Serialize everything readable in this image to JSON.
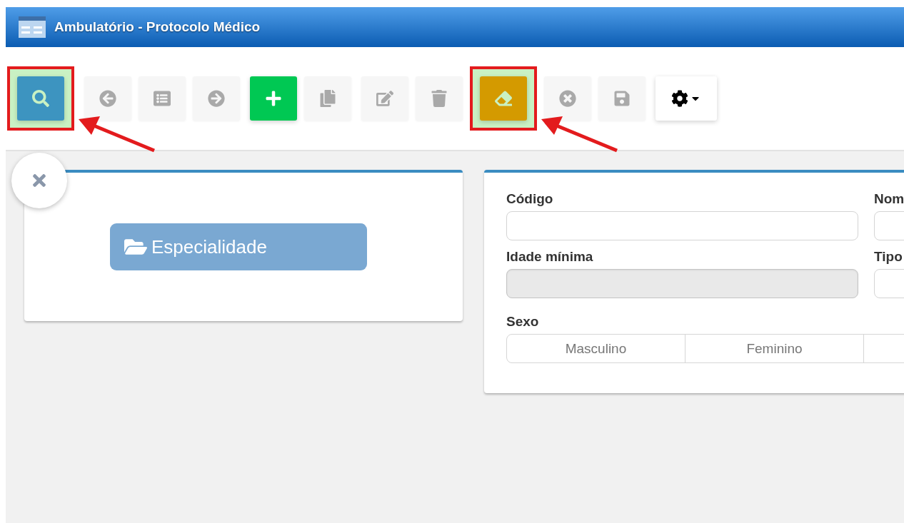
{
  "window": {
    "title": "Ambulatório - Protocolo Médico"
  },
  "toolbar": {
    "groups": [
      {
        "buttons": [
          {
            "kind": "search",
            "disabled": false,
            "marked": true
          }
        ]
      },
      {
        "buttons": [
          {
            "kind": "previous",
            "disabled": true,
            "marked": false
          },
          {
            "kind": "list",
            "disabled": true,
            "marked": false
          },
          {
            "kind": "next",
            "disabled": true,
            "marked": false
          }
        ]
      },
      {
        "buttons": [
          {
            "kind": "new",
            "disabled": false,
            "marked": false
          },
          {
            "kind": "copy",
            "disabled": true,
            "marked": false
          }
        ]
      },
      {
        "buttons": [
          {
            "kind": "edit",
            "disabled": true,
            "marked": false
          },
          {
            "kind": "delete",
            "disabled": true,
            "marked": false
          },
          {
            "kind": "clear",
            "disabled": false,
            "marked": true
          },
          {
            "kind": "cancel",
            "disabled": true,
            "marked": false
          },
          {
            "kind": "save",
            "disabled": true,
            "marked": false
          }
        ]
      },
      {
        "buttons": [
          {
            "kind": "settings",
            "disabled": false,
            "marked": false
          }
        ]
      }
    ]
  },
  "left_panel": {
    "button": "Especialidade"
  },
  "form": {
    "fields": [
      {
        "label": "Código",
        "disabled": false
      },
      {
        "label": "Nom",
        "disabled": false
      },
      {
        "label": "Idade mínima",
        "disabled": true
      },
      {
        "label": "Tipo",
        "disabled": false
      }
    ],
    "sexo": {
      "label": "Sexo",
      "options": [
        {
          "label": "Masculino",
          "selected": false
        },
        {
          "label": "Feminino",
          "selected": false
        }
      ]
    }
  }
}
